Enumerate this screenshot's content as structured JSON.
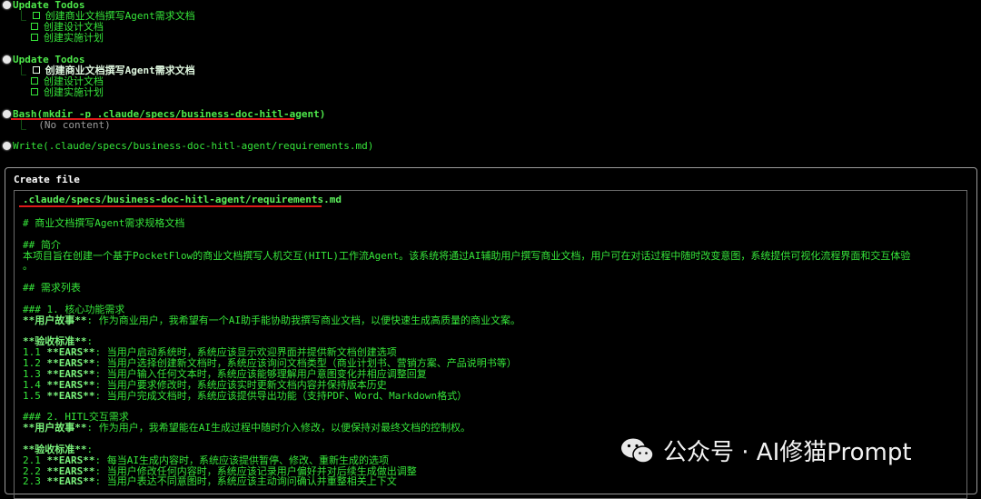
{
  "todo_block_1": {
    "heading": "Update Todos",
    "items": [
      "创建商业文档撰写Agent需求文档",
      "创建设计文档",
      "创建实施计划"
    ]
  },
  "todo_block_2": {
    "heading": "Update Todos",
    "items": [
      "创建商业文档撰写Agent需求文档",
      "创建设计文档",
      "创建实施计划"
    ]
  },
  "bash_call": {
    "text": "Bash(mkdir -p .claude/specs/business-doc-hitl-agent)",
    "result": "(No content)"
  },
  "write_call": {
    "text": "Write(.claude/specs/business-doc-hitl-agent/requirements.md)"
  },
  "create_file": {
    "title": "Create file",
    "path": ".claude/specs/business-doc-hitl-agent/requirements.md",
    "lines": [
      "# 商业文档撰写Agent需求规格文档",
      "",
      "## 简介",
      "本项目旨在创建一个基于PocketFlow的商业文档撰写人机交互(HITL)工作流Agent。该系统将通过AI辅助用户撰写商业文档，用户可在对话过程中随时改变意图，系统提供可视化流程界面和交互体验",
      "。",
      "",
      "## 需求列表",
      "",
      "### 1. 核心功能需求",
      "**用户故事**: 作为商业用户，我希望有一个AI助手能协助我撰写商业文档，以便快速生成高质量的商业文案。",
      "",
      "**验收标准**:",
      "1.1 **EARS**: 当用户启动系统时，系统应该显示欢迎界面并提供新文档创建选项",
      "1.2 **EARS**: 当用户选择创建新文档时，系统应该询问文档类型（商业计划书、营销方案、产品说明书等）",
      "1.3 **EARS**: 当用户输入任何文本时，系统应该能够理解用户意图变化并相应调整回复",
      "1.4 **EARS**: 当用户要求修改时，系统应该实时更新文档内容并保持版本历史",
      "1.5 **EARS**: 当用户完成文档时，系统应该提供导出功能（支持PDF、Word、Markdown格式）",
      "",
      "### 2. HITL交互需求",
      "**用户故事**: 作为用户，我希望能在AI生成过程中随时介入修改，以便保持对最终文档的控制权。",
      "",
      "**验收标准**:",
      "2.1 **EARS**: 每当AI生成内容时，系统应该提供暂停、修改、重新生成的选项",
      "2.2 **EARS**: 当用户修改任何内容时，系统应该记录用户偏好并对后续生成做出调整",
      "2.3 **EARS**: 当用户表达不同意图时，系统应该主动询问确认并重整相关上下文"
    ]
  },
  "watermark": {
    "text": "公众号 · AI修猫Prompt"
  }
}
